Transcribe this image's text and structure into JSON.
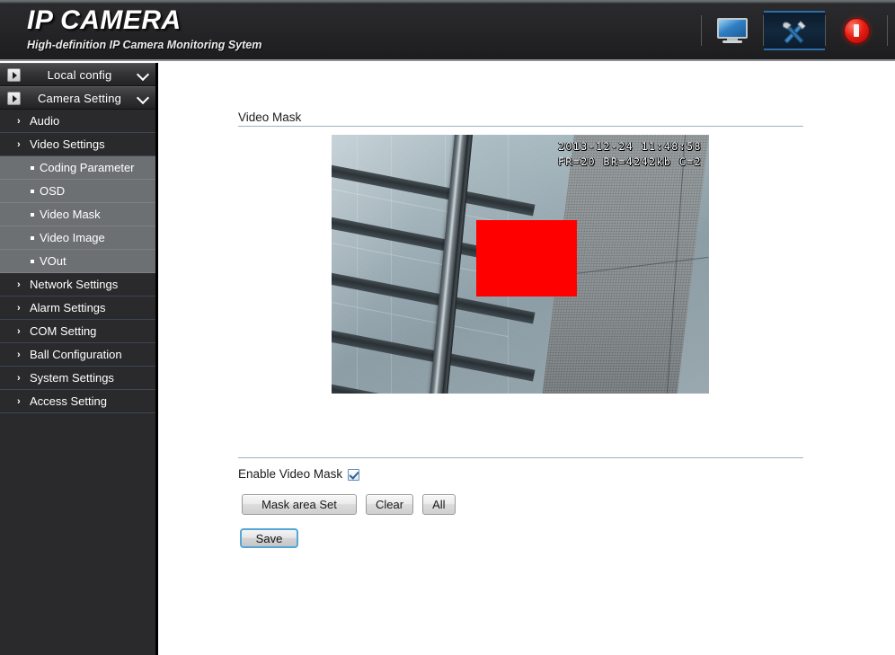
{
  "header": {
    "title": "IP CAMERA",
    "subtitle": "High-definition IP Camera Monitoring Sytem",
    "icons": [
      {
        "name": "monitor-icon",
        "label": "Live View"
      },
      {
        "name": "tools-icon",
        "label": "Configuration"
      },
      {
        "name": "power-icon",
        "label": "Logout"
      }
    ]
  },
  "sidebar": {
    "groups": [
      {
        "label": "Local config",
        "icon": "arrow-square-icon",
        "chevron": "chevron-down-icon"
      },
      {
        "label": "Camera Setting",
        "icon": "arrow-square-icon",
        "chevron": "chevron-down-icon"
      }
    ],
    "items": [
      {
        "label": "Audio",
        "type": "item",
        "marker": "chevron-right-icon"
      },
      {
        "label": "Video Settings",
        "type": "item",
        "marker": "chevron-right-icon"
      },
      {
        "label": "Coding Parameter",
        "type": "sub",
        "marker": "bullet-icon"
      },
      {
        "label": "OSD",
        "type": "sub",
        "marker": "bullet-icon"
      },
      {
        "label": "Video Mask",
        "type": "sub",
        "marker": "bullet-icon"
      },
      {
        "label": "Video Image",
        "type": "sub",
        "marker": "bullet-icon"
      },
      {
        "label": "VOut",
        "type": "sub",
        "marker": "bullet-icon"
      },
      {
        "label": "Network Settings",
        "type": "item",
        "marker": "chevron-right-icon"
      },
      {
        "label": "Alarm Settings",
        "type": "item",
        "marker": "chevron-right-icon"
      },
      {
        "label": "COM Setting",
        "type": "item",
        "marker": "chevron-right-icon"
      },
      {
        "label": "Ball Configuration",
        "type": "item",
        "marker": "chevron-right-icon"
      },
      {
        "label": "System Settings",
        "type": "item",
        "marker": "chevron-right-icon"
      },
      {
        "label": "Access Setting",
        "type": "item",
        "marker": "chevron-right-icon"
      }
    ]
  },
  "main": {
    "page_title": "Video Mask",
    "video": {
      "osd_line1": "2013-12-24 11:48:58",
      "osd_line2": "FR=20 BR=4242kb C=2",
      "mask_color": "#FF0000"
    },
    "enable_label": "Enable Video Mask",
    "enable_checked": true,
    "buttons": {
      "mask_area_set": "Mask area Set",
      "clear": "Clear",
      "all": "All",
      "save": "Save"
    }
  },
  "colors": {
    "accent_blue": "#55a6d8",
    "rule": "#9fb2c4",
    "sidebar_dark": "#2a2a2c",
    "sidebar_sub": "#6d7073",
    "mask_red": "#FF0000"
  }
}
